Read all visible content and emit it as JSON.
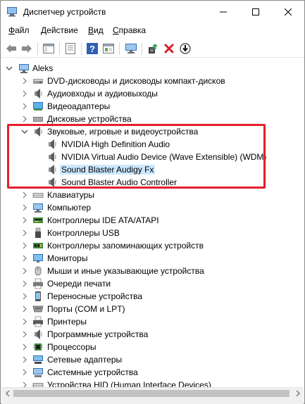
{
  "window": {
    "title": "Диспетчер устройств"
  },
  "menu": [
    {
      "label": "Файл",
      "accel": "Ф",
      "rest": "айл"
    },
    {
      "label": "Действие",
      "accel": "Д",
      "rest": "ействие"
    },
    {
      "label": "Вид",
      "accel": "В",
      "rest": "ид"
    },
    {
      "label": "Справка",
      "accel": "С",
      "rest": "правка"
    }
  ],
  "toolbar": {
    "buttons": [
      "back-arrow-icon",
      "forward-arrow-icon",
      "show-hide-tree-icon",
      "properties-icon",
      "help-icon",
      "console-icon",
      "scan-hardware-icon",
      "update-driver-icon",
      "uninstall-icon",
      "disable-device-icon"
    ]
  },
  "tree": {
    "root": "Aleks",
    "categories": [
      {
        "label": "DVD-дисководы и дисководы компакт-дисков",
        "icon": "dvd-drive-icon"
      },
      {
        "label": "Аудиовходы и аудиовыходы",
        "icon": "speaker-icon"
      },
      {
        "label": "Видеоадаптеры",
        "icon": "display-adapter-icon"
      },
      {
        "label": "Дисковые устройства",
        "icon": "disk-drive-icon"
      },
      {
        "label": "Звуковые, игровые и видеоустройства",
        "icon": "speaker-icon",
        "expanded": true
      },
      {
        "label": "Клавиатуры",
        "icon": "keyboard-icon"
      },
      {
        "label": "Компьютер",
        "icon": "computer-icon"
      },
      {
        "label": "Контроллеры IDE ATA/ATAPI",
        "icon": "ide-controller-icon"
      },
      {
        "label": "Контроллеры USB",
        "icon": "usb-controller-icon"
      },
      {
        "label": "Контроллеры запоминающих устройств",
        "icon": "storage-controller-icon"
      },
      {
        "label": "Мониторы",
        "icon": "monitor-icon"
      },
      {
        "label": "Мыши и иные указывающие устройства",
        "icon": "mouse-icon"
      },
      {
        "label": "Очереди печати",
        "icon": "print-queue-icon"
      },
      {
        "label": "Переносные устройства",
        "icon": "portable-device-icon"
      },
      {
        "label": "Порты (COM и LPT)",
        "icon": "port-icon"
      },
      {
        "label": "Принтеры",
        "icon": "printer-icon"
      },
      {
        "label": "Программные устройства",
        "icon": "software-device-icon"
      },
      {
        "label": "Процессоры",
        "icon": "processor-icon"
      },
      {
        "label": "Сетевые адаптеры",
        "icon": "network-adapter-icon"
      },
      {
        "label": "Системные устройства",
        "icon": "system-device-icon"
      },
      {
        "label": "Устройства HID (Human Interface Devices)",
        "icon": "hid-icon"
      }
    ],
    "sound_children": [
      {
        "label": "NVIDIA High Definition Audio",
        "selected": false
      },
      {
        "label": "NVIDIA Virtual Audio Device (Wave Extensible) (WDM)",
        "selected": false
      },
      {
        "label": "Sound Blaster Audigy Fx",
        "selected": true
      },
      {
        "label": "Sound Blaster Audio Controller",
        "selected": false
      }
    ]
  },
  "colors": {
    "highlight_border": "#e3202b",
    "selection_bg": "#cce8ff",
    "accent_blue": "#1e72c7"
  }
}
